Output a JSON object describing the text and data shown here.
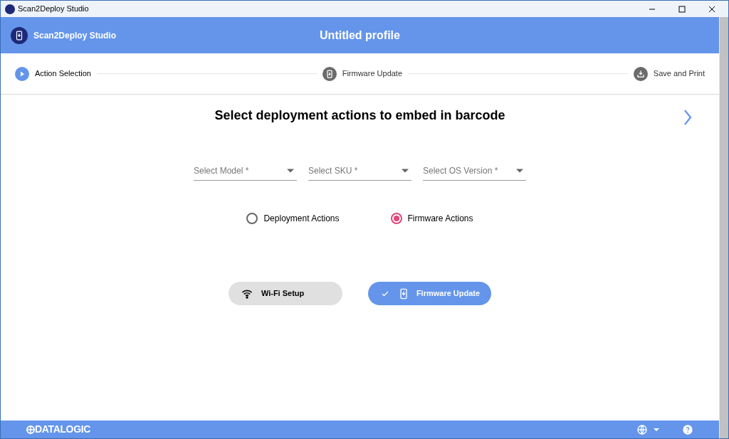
{
  "window": {
    "title": "Scan2Deploy Studio"
  },
  "header": {
    "app_name": "Scan2Deploy Studio",
    "profile_title": "Untitled profile"
  },
  "steps": [
    {
      "label": "Action Selection",
      "kind": "play",
      "selected": true
    },
    {
      "label": "Firmware Update",
      "kind": "device",
      "selected": false
    },
    {
      "label": "Save and Print",
      "kind": "download",
      "selected": false
    }
  ],
  "heading": "Select deployment actions to embed in barcode",
  "selects": [
    {
      "placeholder": "Select Model *"
    },
    {
      "placeholder": "Select SKU *"
    },
    {
      "placeholder": "Select OS Version *"
    }
  ],
  "radios": [
    {
      "label": "Deployment Actions",
      "selected": false
    },
    {
      "label": "Firmware Actions",
      "selected": true
    }
  ],
  "chips": [
    {
      "label": "Wi-Fi Setup",
      "kind": "wifi",
      "selected": false
    },
    {
      "label": "Firmware Update",
      "kind": "device",
      "selected": true
    }
  ],
  "footer": {
    "logo": "DATALOGIC"
  }
}
